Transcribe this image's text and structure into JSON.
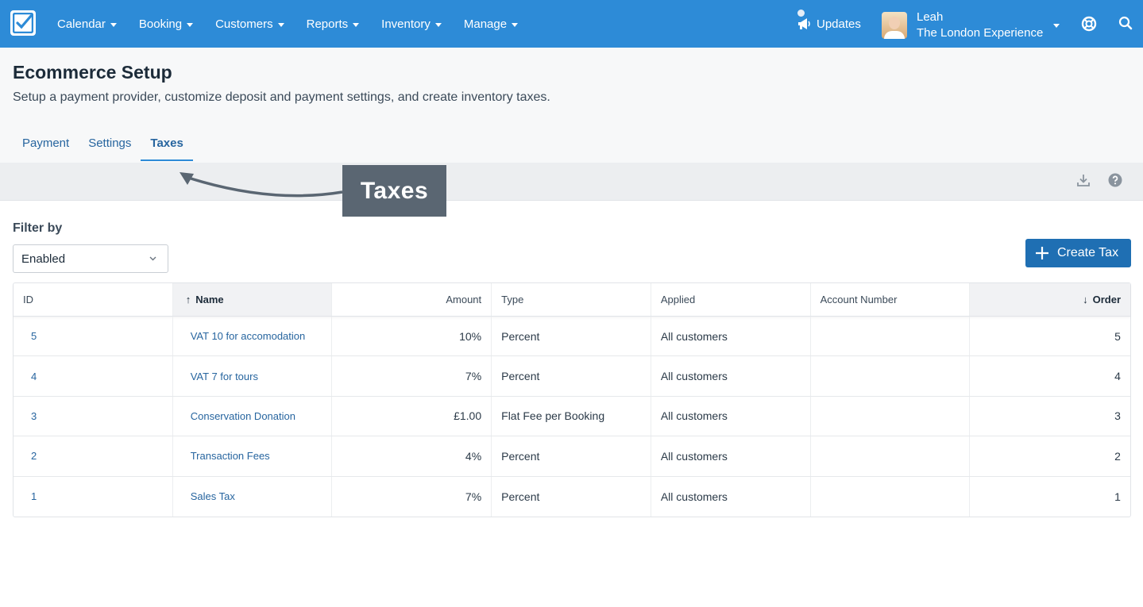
{
  "nav": {
    "items": [
      {
        "label": "Calendar"
      },
      {
        "label": "Booking"
      },
      {
        "label": "Customers"
      },
      {
        "label": "Reports"
      },
      {
        "label": "Inventory"
      },
      {
        "label": "Manage"
      }
    ],
    "updates_label": "Updates",
    "user_name": "Leah",
    "user_org": "The London Experience",
    "accent_color": "#2d8bd7"
  },
  "page": {
    "title": "Ecommerce Setup",
    "subtitle": "Setup a payment provider, customize deposit and payment settings, and create inventory taxes.",
    "tabs": [
      {
        "label": "Payment",
        "active": false
      },
      {
        "label": "Settings",
        "active": false
      },
      {
        "label": "Taxes",
        "active": true
      }
    ]
  },
  "annotation": {
    "label": "Taxes"
  },
  "filter": {
    "label": "Filter by",
    "selected": "Enabled"
  },
  "create_button": {
    "label": "Create Tax"
  },
  "table": {
    "columns": {
      "id": "ID",
      "name": "Name",
      "amount": "Amount",
      "type": "Type",
      "applied": "Applied",
      "account": "Account Number",
      "order": "Order"
    },
    "sort": {
      "name": "↑",
      "order": "↓"
    },
    "rows": [
      {
        "id": "5",
        "name": "VAT 10 for accomodation",
        "amount": "10%",
        "type": "Percent",
        "applied": "All customers",
        "account": "",
        "order": "5"
      },
      {
        "id": "4",
        "name": "VAT 7 for tours",
        "amount": "7%",
        "type": "Percent",
        "applied": "All customers",
        "account": "",
        "order": "4"
      },
      {
        "id": "3",
        "name": "Conservation Donation",
        "amount": "£1.00",
        "type": "Flat Fee per Booking",
        "applied": "All customers",
        "account": "",
        "order": "3"
      },
      {
        "id": "2",
        "name": "Transaction Fees",
        "amount": "4%",
        "type": "Percent",
        "applied": "All customers",
        "account": "",
        "order": "2"
      },
      {
        "id": "1",
        "name": "Sales Tax",
        "amount": "7%",
        "type": "Percent",
        "applied": "All customers",
        "account": "",
        "order": "1"
      }
    ]
  }
}
